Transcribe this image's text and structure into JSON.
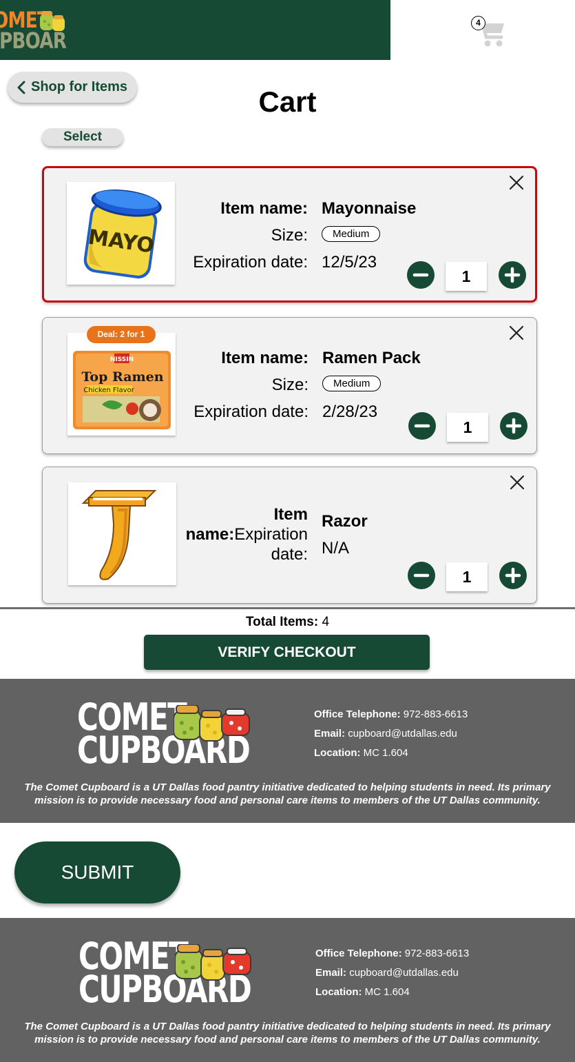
{
  "header": {
    "logo_line1": "OMET",
    "logo_line2": "JPBOAR",
    "cart_count": "4"
  },
  "nav": {
    "back_label": "Shop for Items"
  },
  "page": {
    "title": "Cart",
    "select_label": "Select"
  },
  "cart_items": [
    {
      "name_label": "Item name:",
      "name": "Mayonnaise",
      "size_label": "Size:",
      "size": "Medium",
      "exp_label": "Expiration date:",
      "expiration": "12/5/23",
      "quantity": "1",
      "selected": true,
      "image": "mayo-jar-image"
    },
    {
      "deal": "Deal: 2 for 1",
      "name_label": "Item name:",
      "name": "Ramen Pack",
      "size_label": "Size:",
      "size": "Medium",
      "exp_label": "Expiration date:",
      "expiration": "2/28/23",
      "quantity": "1",
      "selected": false,
      "image": "ramen-pack-image"
    },
    {
      "name_label_1": "Item",
      "name_label_2": "name:",
      "exp_label_1": "Expiration",
      "exp_label_2": "date:",
      "name": "Razor",
      "expiration": "N/A",
      "quantity": "1",
      "selected": false,
      "image": "razor-image"
    }
  ],
  "summary": {
    "total_label": "Total Items:",
    "total_value": "4",
    "verify_label": "VERIFY CHECKOUT"
  },
  "footer": {
    "logo_line1": "COMET",
    "logo_line2": "CUPBOARD",
    "phone_label": "Office Telephone:",
    "phone": "972-883-6613",
    "email_label": "Email:",
    "email": "cupboard@utdallas.edu",
    "location_label": "Location:",
    "location": "MC 1.604",
    "mission_1": "The Comet Cupboard is a UT Dallas food pantry initiative dedicated to helping students in need. Its primary",
    "mission_2": "mission is to provide necessary food and personal care items to members of the UT Dallas community."
  },
  "submit": {
    "label": "SUBMIT"
  },
  "colors": {
    "brand_green": "#174a34",
    "selected_border": "#c40a0a",
    "deal_orange": "#e8731a",
    "footer_gray": "#626262"
  }
}
